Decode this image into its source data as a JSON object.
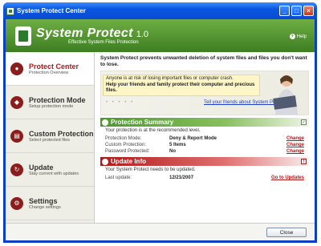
{
  "window": {
    "title": "System Protect Center"
  },
  "header": {
    "brand": "System Protect",
    "version": "1.0",
    "tagline": "Effective System Files Protection",
    "help": "Help"
  },
  "sidebar": {
    "items": [
      {
        "title": "Protect Center",
        "subtitle": "Protection Overview"
      },
      {
        "title": "Protection Mode",
        "subtitle": "Setup protection mode"
      },
      {
        "title": "Custom Protection",
        "subtitle": "Select protected files"
      },
      {
        "title": "Update",
        "subtitle": "Stay current with updates"
      },
      {
        "title": "Settings",
        "subtitle": "Change settings"
      }
    ]
  },
  "main": {
    "intro": "System Protect prevents unwanted deletion of system files and files you don't want to lose.",
    "banner": {
      "line1": "Anyone is at risk of losing important files or computer crash.",
      "line2": "Help your friends and family protect their computer and precious files.",
      "stars": "• • • • •",
      "tell": "Tell your friends about System Protect »"
    },
    "summary": {
      "title": "Protection Summary",
      "note": "Your protection is at the recommended level.",
      "rows": [
        {
          "label": "Protection Mode:",
          "value": "Deny & Report Mode",
          "action": "Change"
        },
        {
          "label": "Custom Protection:",
          "value": "5 Items",
          "action": "Change"
        },
        {
          "label": "Password Protected:",
          "value": "No",
          "action": "Change"
        }
      ]
    },
    "update": {
      "title": "Update Info",
      "note": "Your System Protect needs to be updated.",
      "label": "Last update:",
      "value": "12/21/2007",
      "action": "Go to Updates"
    }
  },
  "footer": {
    "close": "Close"
  }
}
